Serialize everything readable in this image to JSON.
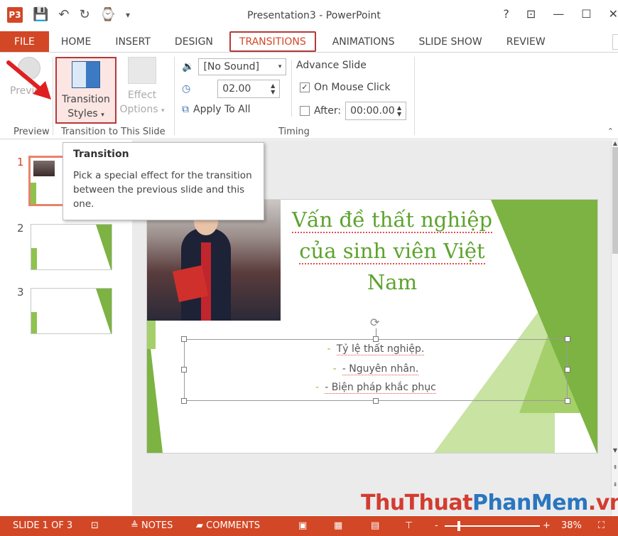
{
  "titlebar": {
    "app_logo": "P3",
    "title": "Presentation3 - PowerPoint",
    "qat_icons": [
      "save-icon",
      "undo-icon",
      "redo-icon",
      "present-icon"
    ],
    "controls": {
      "help": "?",
      "restore_ribbon": "⊡",
      "minimize": "—",
      "maximize": "☐",
      "close": "✕"
    }
  },
  "tabs": [
    {
      "label": "FILE"
    },
    {
      "label": "HOME"
    },
    {
      "label": "INSERT"
    },
    {
      "label": "DESIGN"
    },
    {
      "label": "TRANSITIONS"
    },
    {
      "label": "ANIMATIONS"
    },
    {
      "label": "SLIDE SHOW"
    },
    {
      "label": "REVIEW"
    }
  ],
  "ribbon": {
    "preview": {
      "button_label": "Preview",
      "group_label": "Preview"
    },
    "transition": {
      "styles_line1": "Transition",
      "styles_line2": "Styles",
      "effect_line1": "Effect",
      "effect_line2": "Options",
      "group_label": "Transition to This Slide"
    },
    "timing": {
      "sound_value": "[No Sound]",
      "duration_value": "02.00",
      "apply_all_label": "Apply To All",
      "advance_label": "Advance Slide",
      "on_click_label": "On Mouse Click",
      "on_click_checked": true,
      "after_label": "After:",
      "after_value": "00:00.00",
      "after_checked": false,
      "group_label": "Timing"
    }
  },
  "tooltip": {
    "title": "Transition",
    "body": "Pick a special effect for the transition between the previous slide and this one."
  },
  "slides": [
    {
      "number": "1",
      "current": true
    },
    {
      "number": "2",
      "current": false
    },
    {
      "number": "3",
      "current": false
    }
  ],
  "slide": {
    "title_line1": "Vấn đề thất nghiệp",
    "title_line2": "của sinh viên Việt",
    "title_line3": "Nam",
    "bullets": [
      "Tỷ lệ thất nghiệp.",
      "- Nguyên nhân.",
      "- Biện pháp khắc phục"
    ]
  },
  "statusbar": {
    "slide_info": "SLIDE 1 OF 3",
    "notes": "NOTES",
    "comments": "COMMENTS",
    "zoom_minus": "-",
    "zoom_plus": "+",
    "zoom": "38%",
    "zoom_level": 0.38
  },
  "watermark": {
    "part1": "ThuThuat",
    "part2": "PhanMem",
    "part3": ".vn"
  },
  "colors": {
    "accent": "#d24726",
    "slide_green": "#5da32e",
    "highlight_border": "#b33a3a"
  }
}
